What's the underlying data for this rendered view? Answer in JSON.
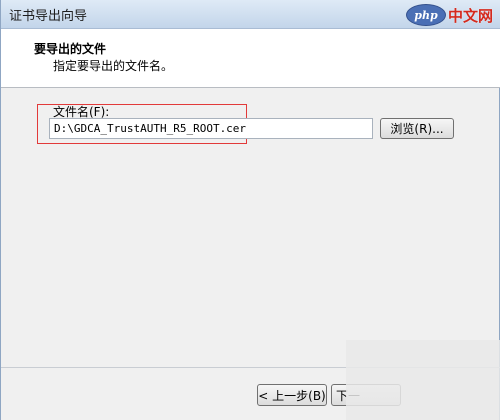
{
  "window": {
    "title": "证书导出向导"
  },
  "watermark": {
    "brand": "php",
    "site": "中文网"
  },
  "header": {
    "title": "要导出的文件",
    "subtitle": "指定要导出的文件名。"
  },
  "form": {
    "filename_label": "文件名(F):",
    "filename_value": "D:\\GDCA_TrustAUTH_R5_ROOT.cer",
    "browse_label": "浏览(R)..."
  },
  "footer": {
    "back_label": "< 上一步(B)",
    "next_label": "下一"
  }
}
